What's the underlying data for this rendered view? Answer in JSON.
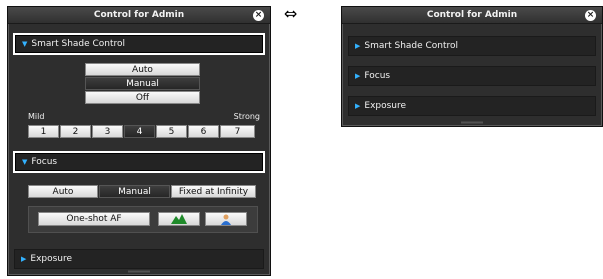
{
  "arrow": "⇔",
  "expanded": {
    "title": "Control for Admin",
    "close_icon": "×",
    "smart_shade": {
      "label": "Smart Shade Control",
      "modes": [
        "Auto",
        "Manual",
        "Off"
      ],
      "selected_mode": "Manual",
      "mild_label": "Mild",
      "strong_label": "Strong",
      "levels": [
        "1",
        "2",
        "3",
        "4",
        "5",
        "6",
        "7"
      ],
      "selected_level": "4"
    },
    "focus": {
      "label": "Focus",
      "modes": [
        "Auto",
        "Manual",
        "Fixed at Infinity"
      ],
      "selected_mode": "Manual",
      "oneshot_label": "One-shot AF",
      "landscape_icon": "landscape-icon",
      "portrait_icon": "portrait-icon"
    },
    "exposure": {
      "label": "Exposure"
    }
  },
  "collapsed": {
    "title": "Control for Admin",
    "close_icon": "×",
    "sections": [
      "Smart Shade Control",
      "Focus",
      "Exposure"
    ]
  },
  "colors": {
    "accent": "#33b2ff",
    "panel": "#2e2e2e",
    "selected": "#2e2e2e"
  }
}
